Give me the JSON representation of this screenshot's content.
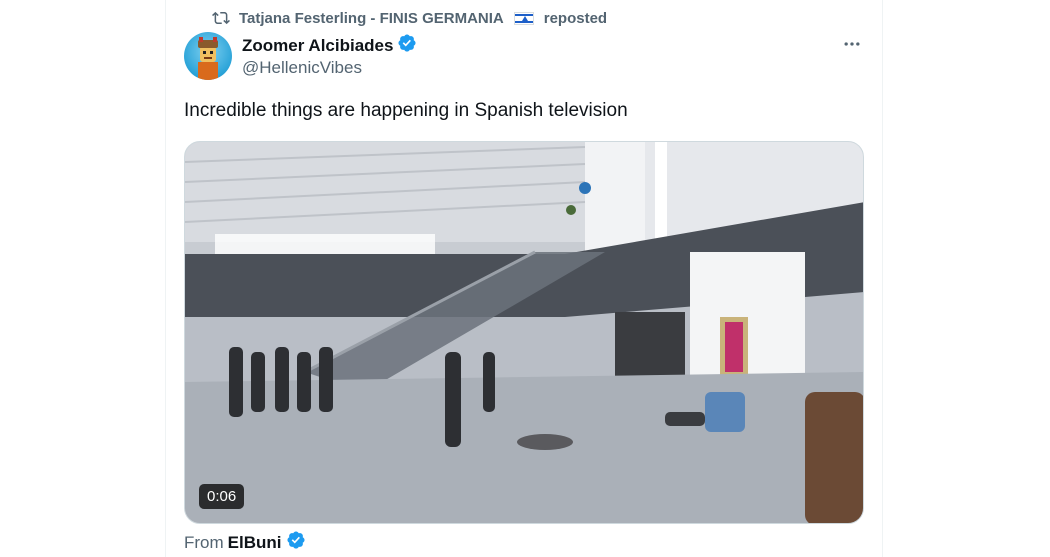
{
  "repost_banner": {
    "reposter_name": "Tatjana Festerling - FINIS GERMANIA",
    "flag_icon": "israel-flag-icon",
    "action_label": "reposted"
  },
  "tweet": {
    "author_name": "Zoomer Alcibiades",
    "author_handle": "@HellenicVibes",
    "verified": true,
    "text": "Incredible things are happening in Spanish television",
    "more_icon": "more-options-icon"
  },
  "media": {
    "type": "video",
    "duration": "0:06"
  },
  "source": {
    "prefix": "From",
    "name": "ElBuni",
    "verified": true
  },
  "colors": {
    "verified_blue": "#1d9bf0",
    "secondary_text": "#536471",
    "primary_text": "#0f1419"
  }
}
